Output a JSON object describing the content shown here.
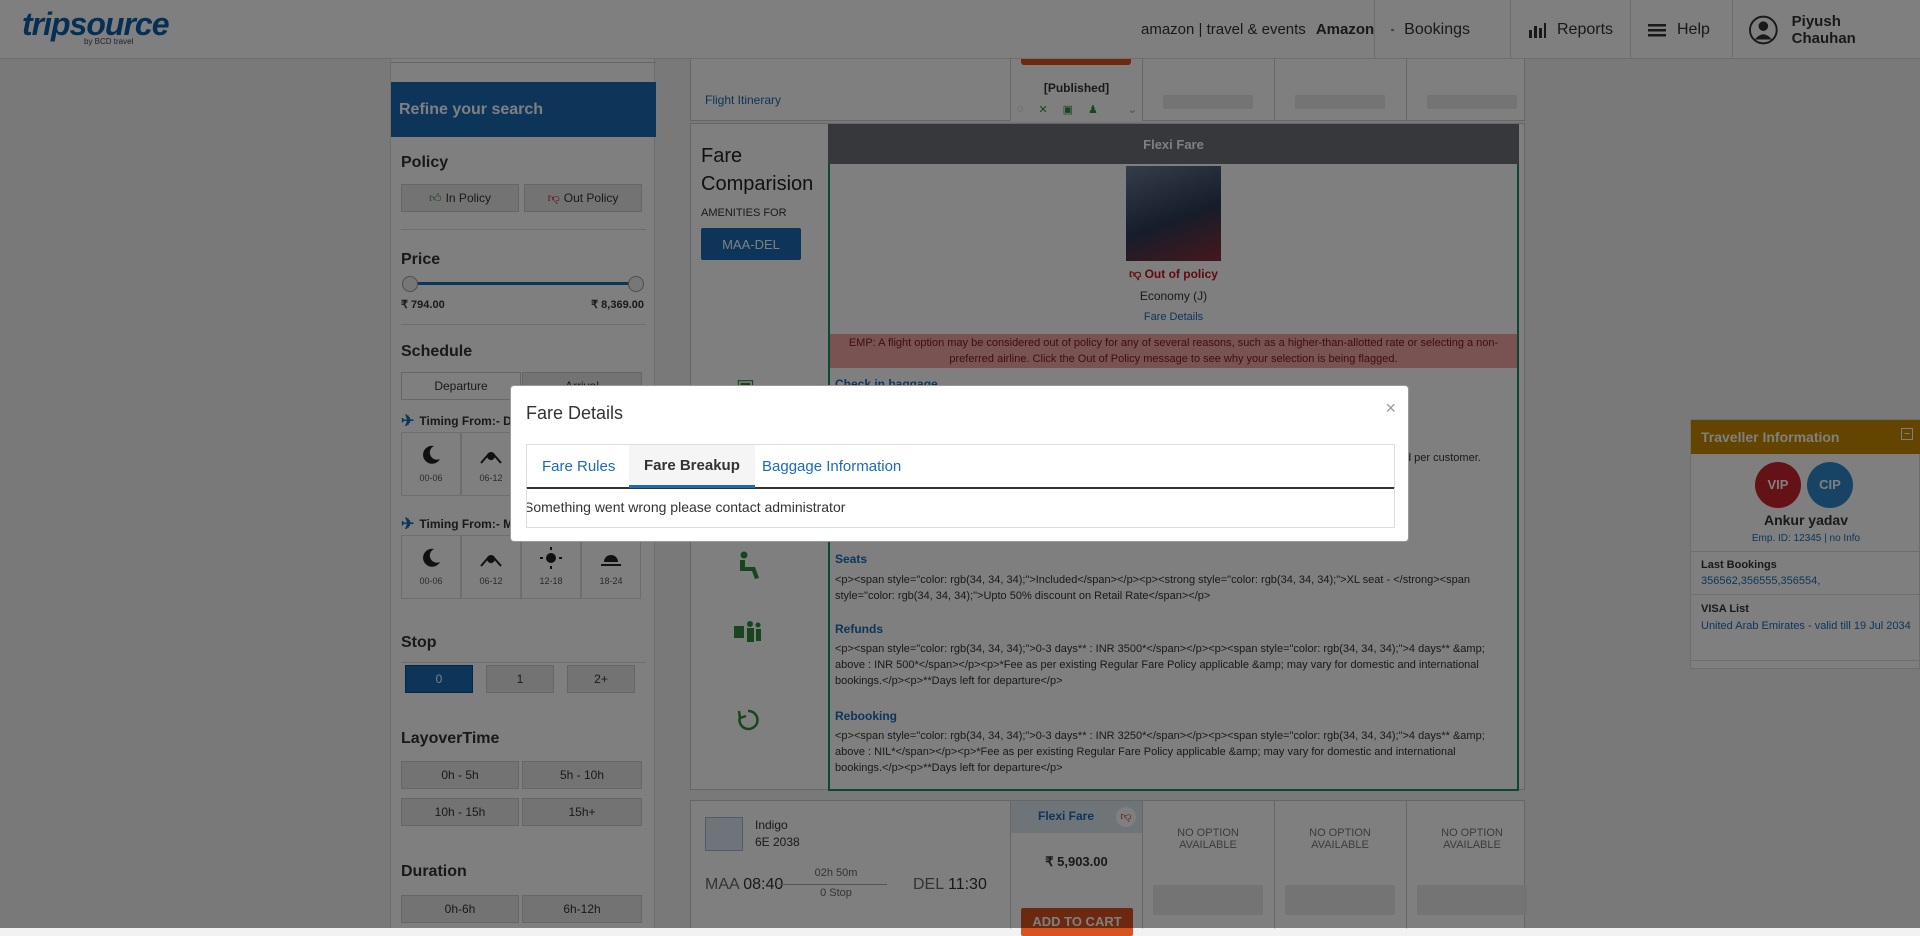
{
  "header": {
    "logo": "tripsource",
    "logo_sub": "by BCD travel",
    "company_brand": "amazon | travel & events",
    "company": "Amazon",
    "nav": [
      {
        "label": "Bookings",
        "icon": "list-icon"
      },
      {
        "label": "Reports",
        "icon": "bar-chart-icon"
      },
      {
        "label": "Help",
        "icon": "list-icon"
      }
    ],
    "user": "Piyush Chauhan"
  },
  "sidebar": {
    "refine_title": "Refine your search",
    "policy": {
      "title": "Policy",
      "in": "In Policy",
      "out": "Out Policy"
    },
    "price": {
      "title": "Price",
      "min": "₹ 794.00",
      "max": "₹ 8,369.00",
      "range_fraction": [
        0.0,
        1.0
      ]
    },
    "schedule": {
      "title": "Schedule",
      "tabs": [
        "Departure",
        "Arrival"
      ],
      "timing1": "Timing From:- Delhi",
      "timing2": "Timing From:- Mumbai",
      "slots": [
        "00-06",
        "06-12",
        "12-18",
        "18-24"
      ]
    },
    "stop": {
      "title": "Stop",
      "options": [
        "0",
        "1",
        "2+"
      ],
      "selected": "0"
    },
    "layover": {
      "title": "LayoverTime",
      "options": [
        "0h - 5h",
        "5h - 10h",
        "10h - 15h",
        "15h+"
      ]
    },
    "duration": {
      "title": "Duration",
      "options": [
        "0h-6h",
        "6h-12h"
      ]
    }
  },
  "itinerary": {
    "link": "Flight Itinerary",
    "published": "[Published]"
  },
  "comparison": {
    "title_line1": "Fare",
    "title_line2": "Comparision",
    "amenities_for": "AMENITIES FOR",
    "route_button": "MAA-DEL",
    "fare_header": "Flexi Fare",
    "policy_status": "Out of policy",
    "cabin": "Economy (J)",
    "fare_details_link": "Fare Details",
    "emp_notice": "EMP: A flight option may be considered out of policy for any of several reasons, such as a higher-than-allotted rate or selecting a non-preferred airline. Click the Out of Policy message to see why your selection is being flagged.",
    "checkin_title": "Check in baggage",
    "checkin_tail": "d per customer.",
    "seats_title": "Seats",
    "seats_text": "<p><span style=\"color: rgb(34, 34, 34);\">Included</span></p><p><strong style=\"color: rgb(34, 34, 34);\">XL seat - </strong><span style=\"color: rgb(34, 34, 34);\">Upto 50% discount on Retail Rate</span></p>",
    "refunds_title": "Refunds",
    "refunds_text": "<p><span style=\"color: rgb(34, 34, 34);\">0-3 days** : INR 3500*</span></p><p><span style=\"color: rgb(34, 34, 34);\">4 days** &amp; above : INR 500*</span></p><p>*Fee as per existing Regular Fare Policy applicable &amp; may vary for domestic and international bookings.</p><p>**Days left for departure</p>",
    "rebooking_title": "Rebooking",
    "rebooking_text": "<p><span style=\"color: rgb(34, 34, 34);\">0-3 days** : INR 3250*</span></p><p><span style=\"color: rgb(34, 34, 34);\">4 days** &amp; above : NIL*</span></p><p>*Fee as per existing Regular Fare Policy applicable &amp; may vary for domestic and international bookings.</p><p>**Days left for departure</p>"
  },
  "flight2": {
    "airline": "Indigo",
    "flight_no": "6E  2038",
    "from": "MAA",
    "dep": "08:40",
    "duration": "02h 50m",
    "stops": "0 Stop",
    "to": "DEL",
    "arr": "11:30",
    "fare_label": "Flexi Fare",
    "price": "₹ 5,903.00",
    "add_to_cart": "ADD TO CART",
    "no_option": "NO OPTION AVAILABLE"
  },
  "modal": {
    "title": "Fare Details",
    "close": "×",
    "tabs": [
      "Fare Rules",
      "Fare Breakup",
      "Baggage Information"
    ],
    "active_tab": "Fare Breakup",
    "message": "Something went wrong please contact administrator"
  },
  "traveller": {
    "title": "Traveller Information",
    "badges": [
      "VIP",
      "CIP"
    ],
    "name": "Ankur yadav",
    "emp_id": "Emp. ID: 12345 | no Info",
    "last_bookings_label": "Last Bookings",
    "last_bookings": "356562,356555,356554,",
    "visa_label": "VISA List",
    "visa": "United Arab Emirates - valid till 19 Jul 2034"
  },
  "colors": {
    "brand": "#1b6bb5",
    "green": "#2e8b3a",
    "out_policy": "#c0141c",
    "orange": "#d9531e",
    "traveller_header": "#c78a00"
  }
}
